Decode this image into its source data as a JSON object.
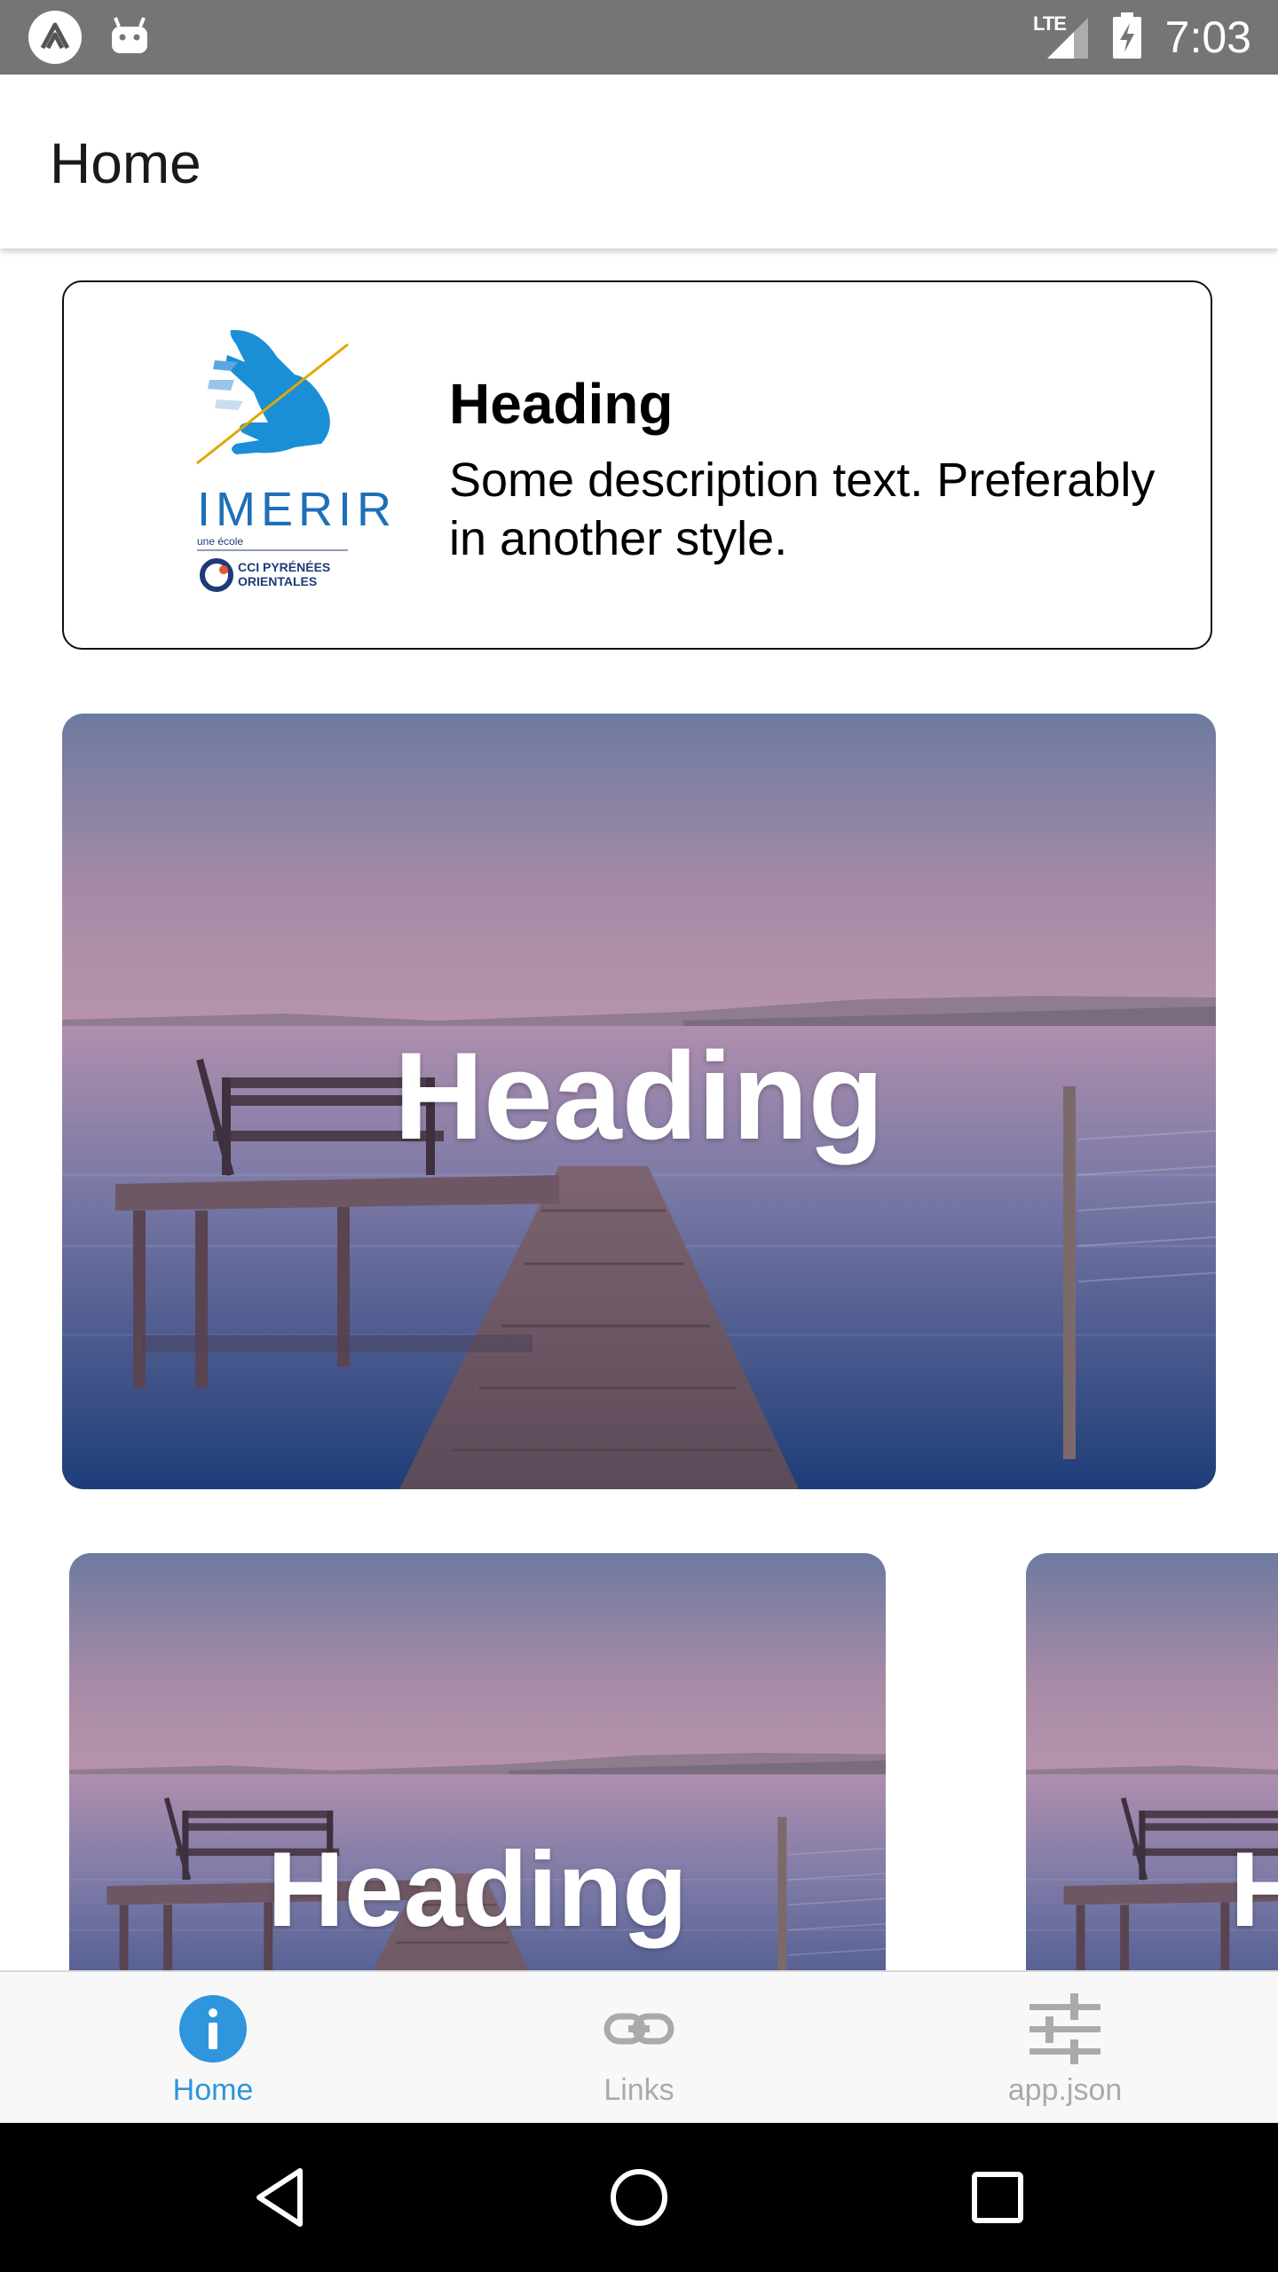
{
  "status_bar": {
    "time": "7:03",
    "network": "LTE",
    "icons": [
      "expo-icon",
      "android-icon",
      "signal-icon",
      "battery-charging-icon"
    ]
  },
  "header": {
    "title": "Home"
  },
  "info_card": {
    "logo": {
      "name": "imerir-logo",
      "wordmark": "IMERIR",
      "tagline": "une école",
      "partner": "CCI PYRÉNÉES ORIENTALES"
    },
    "heading": "Heading",
    "description": "Some description text. Preferably in another style."
  },
  "hero_card": {
    "heading": "Heading"
  },
  "carousel": [
    {
      "heading": "Heading"
    },
    {
      "heading": "Heading"
    }
  ],
  "tabs": [
    {
      "label": "Home",
      "icon": "info-icon",
      "active": true
    },
    {
      "label": "Links",
      "icon": "link-icon",
      "active": false
    },
    {
      "label": "app.json",
      "icon": "sliders-icon",
      "active": false
    }
  ],
  "colors": {
    "status_bar": "#757575",
    "tab_active": "#2f95dc",
    "tab_inactive": "#aaaaaa",
    "logo_blue": "#1a8fd6",
    "logo_navy": "#1e3a78"
  },
  "nav_bar": {
    "buttons": [
      "back-icon",
      "home-icon",
      "recents-icon"
    ]
  }
}
